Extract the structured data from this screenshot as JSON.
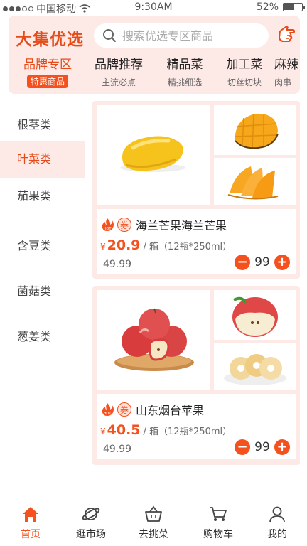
{
  "status_bar": {
    "carrier": "中国移动",
    "time": "9:30AM",
    "battery": "52%",
    "battery_level": 0.52
  },
  "header": {
    "brand": "大集优选",
    "search_placeholder": "搜索优选专区商品"
  },
  "tabs": [
    {
      "title": "品牌专区",
      "sub": "特惠商品",
      "active": true
    },
    {
      "title": "品牌推荐",
      "sub": "主流必点"
    },
    {
      "title": "精品菜",
      "sub": "精挑细选"
    },
    {
      "title": "加工菜",
      "sub": "切丝切块"
    },
    {
      "title": "麻辣",
      "sub": "肉串"
    }
  ],
  "categories": [
    {
      "label": "根茎类"
    },
    {
      "label": "叶菜类",
      "active": true
    },
    {
      "label": "茄果类"
    },
    {
      "label": "含豆类"
    },
    {
      "label": "菌菇类"
    },
    {
      "label": "葱姜类"
    }
  ],
  "products": [
    {
      "name": "海兰芒果海兰芒果",
      "coupon": "券",
      "hot": "HOT",
      "currency": "¥",
      "price": "20.9",
      "unit": "/ 箱（12瓶*250ml）",
      "original": "49.99",
      "qty": "99"
    },
    {
      "name": "山东烟台苹果",
      "coupon": "券",
      "hot": "HOT",
      "currency": "¥",
      "price": "40.5",
      "unit": "/ 箱（12瓶*250ml）",
      "original": "49.99",
      "qty": "99"
    }
  ],
  "bottom_nav": [
    {
      "label": "首页",
      "icon": "home-icon",
      "active": true
    },
    {
      "label": "逛市场",
      "icon": "planet-icon"
    },
    {
      "label": "去挑菜",
      "icon": "basket-icon"
    },
    {
      "label": "购物车",
      "icon": "cart-icon"
    },
    {
      "label": "我的",
      "icon": "user-icon"
    }
  ],
  "colors": {
    "accent": "#f4511e",
    "brand": "#e64a19",
    "tint": "#fde9e6"
  }
}
